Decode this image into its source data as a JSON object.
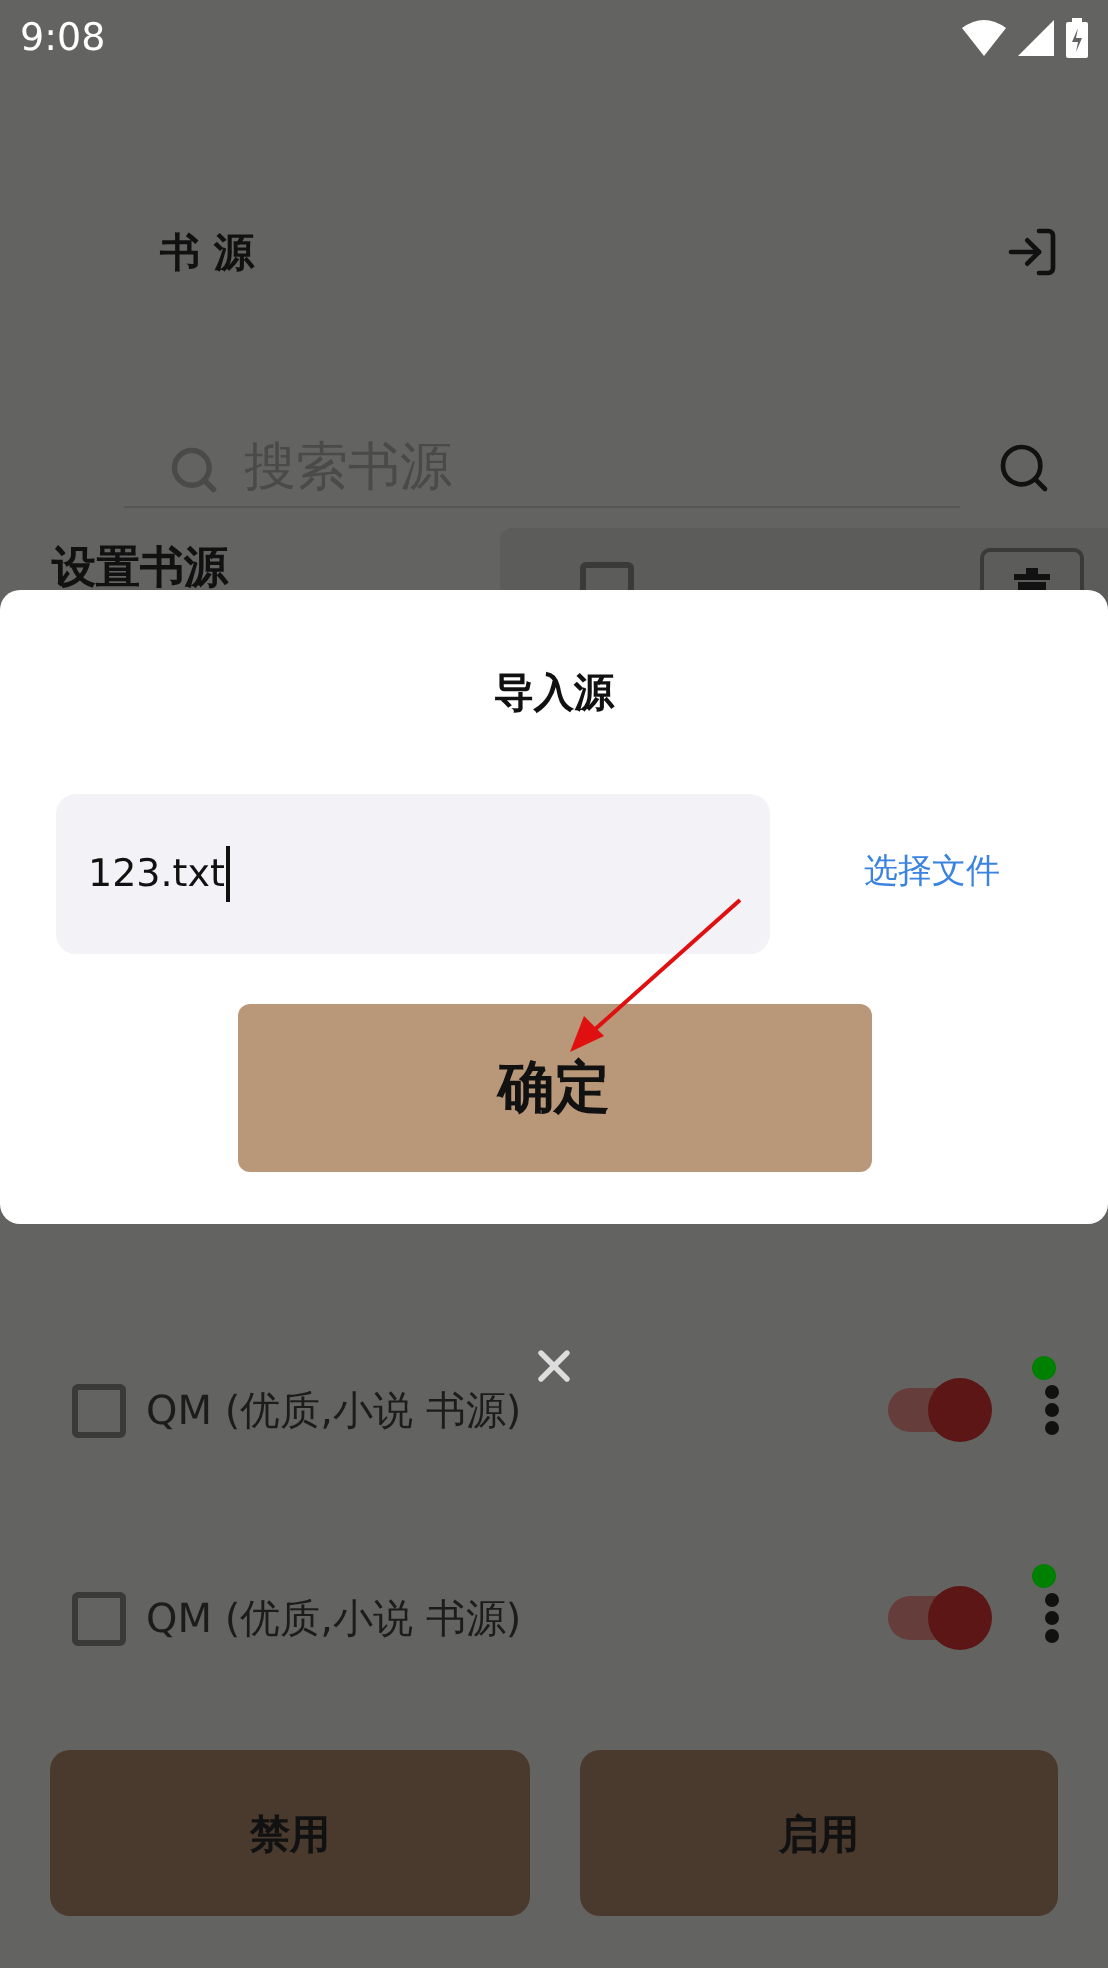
{
  "status_bar": {
    "time": "9:08"
  },
  "header": {
    "title": "书 源"
  },
  "search": {
    "placeholder": "搜索书源"
  },
  "section": {
    "title": "设置书源"
  },
  "sources": [
    {
      "name": "QM (优质,小说 书源)",
      "checked": false,
      "enabled": true,
      "online": true
    },
    {
      "name": "QM (优质,小说 书源)",
      "checked": false,
      "enabled": true,
      "online": true
    }
  ],
  "actions": [
    "禁用",
    "启用"
  ],
  "dialog": {
    "title": "导入源",
    "field_value": "123.txt",
    "pick_file": "选择文件",
    "confirm": "确定"
  }
}
